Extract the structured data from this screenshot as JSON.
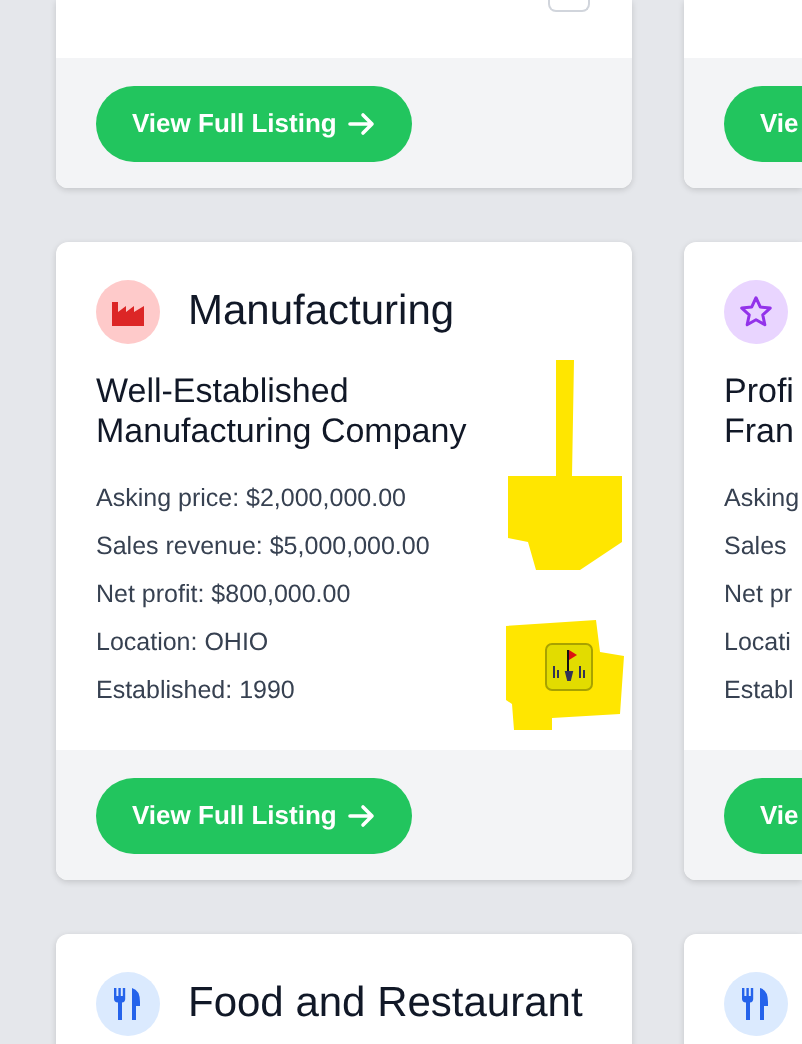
{
  "listings": [
    {
      "kind": "footer",
      "button": {
        "label": "View Full Listing",
        "arrow": true
      }
    },
    {
      "kind": "footer",
      "button": {
        "label": "Vie"
      }
    },
    {
      "kind": "full",
      "icon": {
        "kind": "factory"
      },
      "category": "Manufacturing",
      "title": "Well-Established Manufacturing Company",
      "details": [
        "Asking price: $2,000,000.00",
        "Sales revenue: $5,000,000.00",
        "Net profit: $800,000.00",
        "Location: OHIO",
        "Established: 1990"
      ],
      "button": {
        "label": "View Full Listing",
        "arrow": true
      },
      "annotated": true
    },
    {
      "kind": "full",
      "icon": {
        "kind": "star"
      },
      "title": "Profi Fran",
      "details": [
        "Asking",
        "Sales",
        "Net pr",
        "Locati",
        "Establ"
      ],
      "button": {
        "label": "Vie"
      }
    },
    {
      "kind": "header",
      "icon": {
        "kind": "utensils"
      },
      "category": "Food and Restaurant"
    },
    {
      "kind": "header",
      "icon": {
        "kind": "utensils"
      }
    }
  ]
}
